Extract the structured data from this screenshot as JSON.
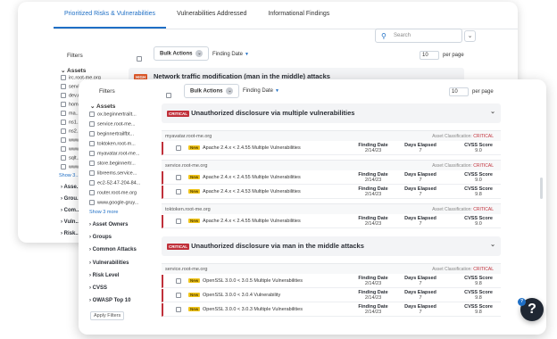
{
  "tabs": [
    {
      "label": "Prioritized Risks & Vulnerabilities"
    },
    {
      "label": "Vulnerabilities Addressed"
    },
    {
      "label": "Informational Findings"
    }
  ],
  "back": {
    "filters_label": "Filters",
    "assets_label": "Assets",
    "assets": [
      "irc.root-me.org",
      "service.root-me.o",
      "dev.r...",
      "hom...",
      "ma...",
      "ns1...",
      "ns2...",
      "www...",
      "www...",
      "sqlt...",
      "www..."
    ],
    "show_more": "Show 3...",
    "side_groups": [
      "Asse...",
      "Grou...",
      "Com...",
      "Vuln...",
      "Risk..."
    ],
    "search_placeholder": "Search",
    "bulk_actions": "Bulk Actions",
    "sort_label": "Finding Date",
    "per_page_value": "10",
    "per_page_label": "per page",
    "first_group": {
      "severity": "HIGH",
      "title": "Network traffic modification (man in the middle) attacks"
    }
  },
  "front": {
    "filters_label": "Filters",
    "assets_label": "Assets",
    "assets": [
      "ox.beginnertrailt...",
      "service.root-me...",
      "beginnertrailfbt...",
      "toktoken.root-m...",
      "myavatar.root-me...",
      "store.beginnertr...",
      "libreems.service...",
      "ec2-52-47-204-84...",
      "router.root-me.org",
      "www.google-gruy..."
    ],
    "show_more": "Show 3 more",
    "side_groups": [
      "Asset Owners",
      "Groups",
      "Common Attacks",
      "Vulnerabilities",
      "Risk Level",
      "CVSS",
      "OWASP Top 10"
    ],
    "apply_filters": "Apply Filters",
    "bulk_actions": "Bulk Actions",
    "sort_label": "Finding Date",
    "per_page_value": "10",
    "per_page_label": "per page",
    "col_finding_date": "Finding Date",
    "col_days_elapsed": "Days Elapsed",
    "col_cvss": "CVSS Score",
    "asset_class_label": "Asset Classification:",
    "asset_class_value": "CRITICAL",
    "new_label": "New",
    "group1": {
      "severity": "CRITICAL",
      "title": "Unauthorized disclosure via multiple vulnerabilities",
      "hosts": [
        {
          "name": "myavatar.root-me.org",
          "rows": [
            {
              "title": "Apache 2.4.x < 2.4.55 Multiple Vulnerabilities",
              "date": "2/14/23",
              "days": "7",
              "cvss": "9.0"
            }
          ]
        },
        {
          "name": "service.root-me.org",
          "rows": [
            {
              "title": "Apache 2.4.x < 2.4.55 Multiple Vulnerabilities",
              "date": "2/14/23",
              "days": "7",
              "cvss": "9.0"
            },
            {
              "title": "Apache 2.4.x < 2.4.53 Multiple Vulnerabilities",
              "date": "2/14/23",
              "days": "7",
              "cvss": "9.8"
            }
          ]
        },
        {
          "name": "toktoken.root-me.org",
          "rows": [
            {
              "title": "Apache 2.4.x < 2.4.55 Multiple Vulnerabilities",
              "date": "2/14/23",
              "days": "7",
              "cvss": "9.0"
            }
          ]
        }
      ]
    },
    "group2": {
      "severity": "CRITICAL",
      "title": "Unauthorized disclosure via man in the middle attacks",
      "hosts": [
        {
          "name": "service.root-me.org",
          "rows": [
            {
              "title": "OpenSSL 3.0.0 < 3.0.5 Multiple Vulnerabilities",
              "date": "2/14/23",
              "days": "7",
              "cvss": "9.8"
            },
            {
              "title": "OpenSSL 3.0.0 < 3.0.4 Vulnerability",
              "date": "2/14/23",
              "days": "7",
              "cvss": "9.8"
            },
            {
              "title": "OpenSSL 3.0.0 < 3.0.3 Multiple Vulnerabilities",
              "date": "2/14/23",
              "days": "7",
              "cvss": "9.8"
            }
          ]
        }
      ]
    }
  },
  "help": {
    "label": "?",
    "badge": "?"
  }
}
